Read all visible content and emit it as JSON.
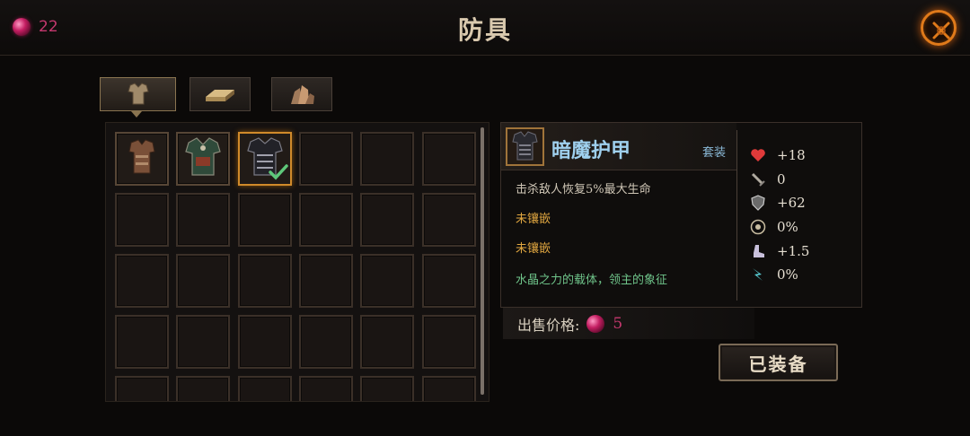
{
  "header": {
    "currency_count": "22",
    "title": "防具",
    "close_icon": "close-icon"
  },
  "tabs": [
    {
      "name": "armor",
      "icon": "armor-icon",
      "active": true
    },
    {
      "name": "materials",
      "icon": "ingot-icon",
      "active": false
    },
    {
      "name": "crystals",
      "icon": "crystal-icon",
      "active": false
    }
  ],
  "inventory": {
    "columns": 6,
    "visible_rows": 5,
    "items": [
      {
        "slot": 0,
        "icon": "leather-armor-icon"
      },
      {
        "slot": 1,
        "icon": "scaled-armor-icon"
      },
      {
        "slot": 2,
        "icon": "dark-armor-icon",
        "equipped": true,
        "selected": true
      }
    ]
  },
  "detail": {
    "item_name": "暗魔护甲",
    "set_label": "套装",
    "effect": "击杀敌人恢复5%最大生命",
    "socket1": "未镶嵌",
    "socket2": "未镶嵌",
    "flavor": "水晶之力的载体，领主的象征",
    "stats": [
      {
        "icon": "heart-icon",
        "value": "+18"
      },
      {
        "icon": "sword-icon",
        "value": "0"
      },
      {
        "icon": "shield-icon",
        "value": "+62"
      },
      {
        "icon": "crit-icon",
        "value": "0%"
      },
      {
        "icon": "boot-icon",
        "value": "+1.5"
      },
      {
        "icon": "lifesteal-icon",
        "value": "0%"
      }
    ]
  },
  "sell": {
    "label": "出售价格:",
    "price": "5"
  },
  "equip_button": "已装备",
  "colors": {
    "currency": "#c4386e",
    "item_name": "#9fd0ee",
    "socket_text": "#e0a640",
    "flavor_text": "#6fc48a",
    "selected_border": "#d08a2a"
  }
}
